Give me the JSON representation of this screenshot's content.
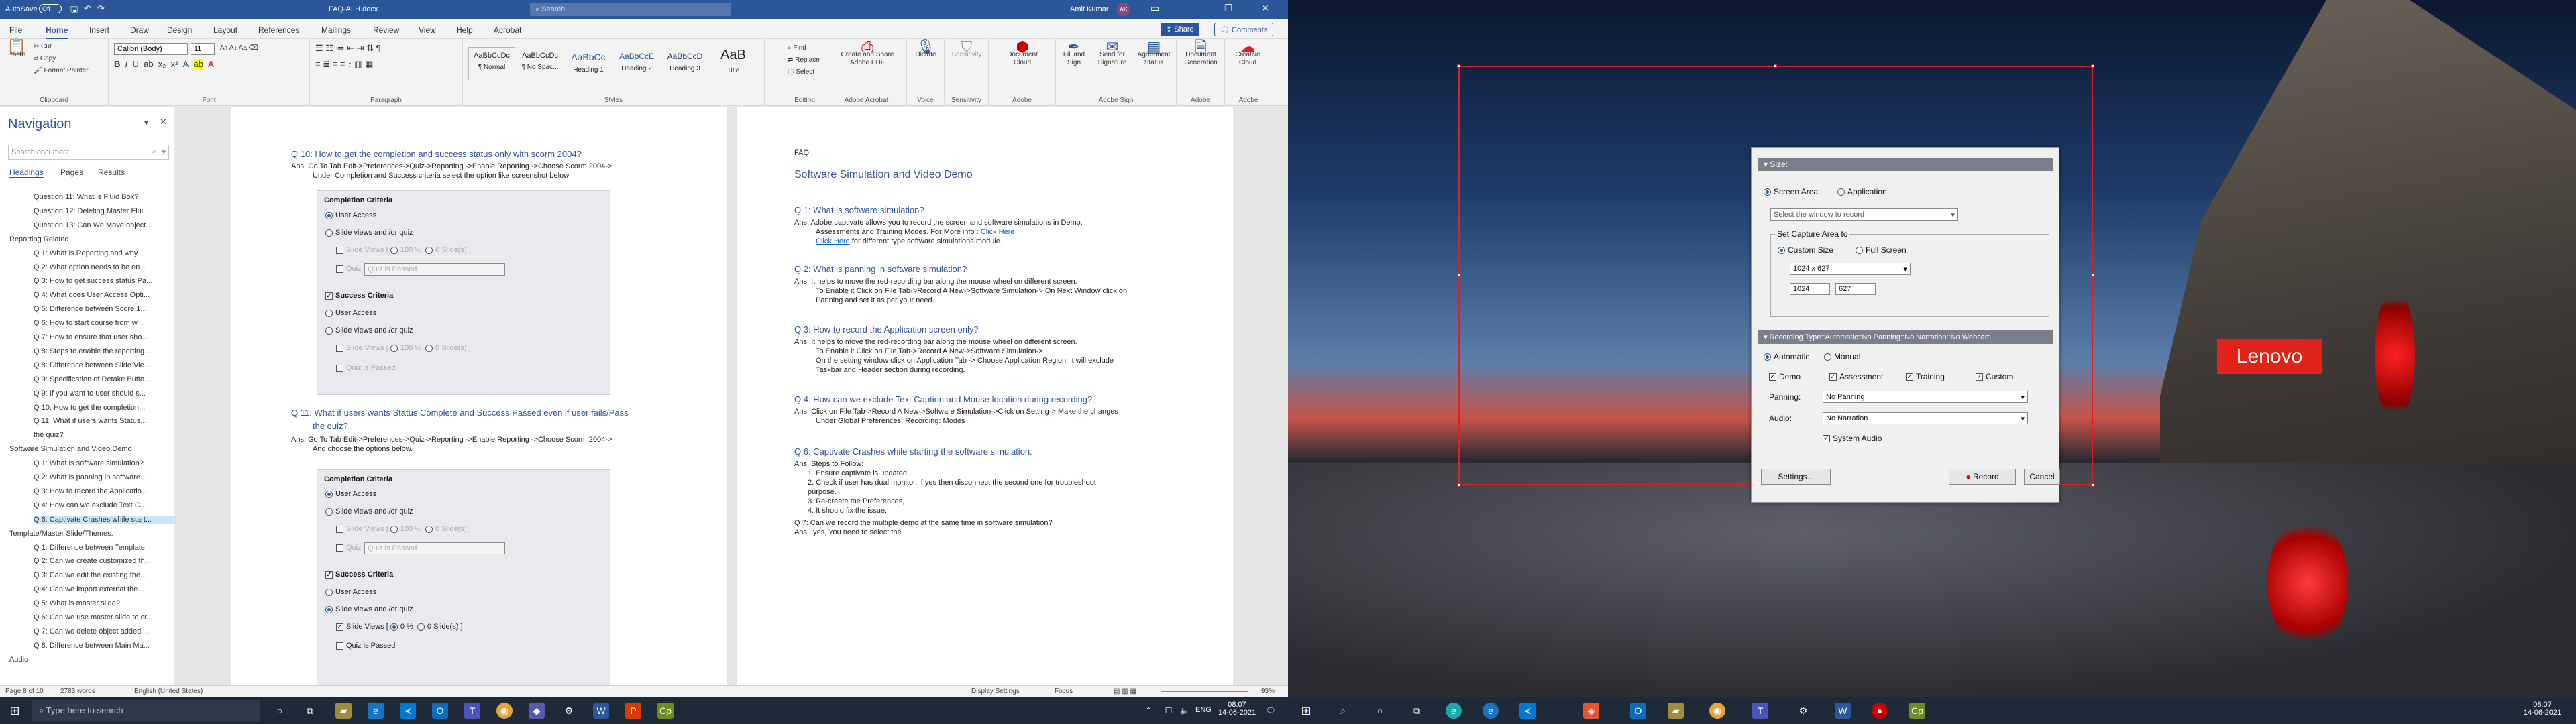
{
  "window": {
    "autosave": "AutoSave",
    "autosave_state": "Off",
    "doc_title": "FAQ-ALH.docx",
    "search": "Search",
    "user": "Amit Kumar",
    "user_initials": "AK",
    "share": "Share",
    "comments": "Comments"
  },
  "menu": [
    "File",
    "Home",
    "Insert",
    "Draw",
    "Design",
    "Layout",
    "References",
    "Mailings",
    "Review",
    "View",
    "Help",
    "Acrobat"
  ],
  "ribbon": {
    "clipboard": {
      "paste": "Paste",
      "cut": "Cut",
      "copy": "Copy",
      "format_painter": "Format Painter",
      "label": "Clipboard"
    },
    "font": {
      "name": "Calibri (Body)",
      "size": "11",
      "label": "Font"
    },
    "paragraph": {
      "label": "Paragraph"
    },
    "styles": {
      "items": [
        {
          "preview": "AaBbCcDc",
          "name": "¶ Normal"
        },
        {
          "preview": "AaBbCcDc",
          "name": "¶ No Spac..."
        },
        {
          "preview": "AaBbCc",
          "name": "Heading 1"
        },
        {
          "preview": "AaBbCcE",
          "name": "Heading 2"
        },
        {
          "preview": "AaBbCcD",
          "name": "Heading 3"
        },
        {
          "preview": "AaB",
          "name": "Title"
        }
      ],
      "label": "Styles"
    },
    "editing": {
      "find": "Find",
      "replace": "Replace",
      "select": "Select",
      "label": "Editing"
    },
    "acrobat": {
      "create": "Create and Share Adobe PDF",
      "label": "Adobe Acrobat"
    },
    "voice": {
      "dictate": "Dictate",
      "label": "Voice"
    },
    "sensitivity": {
      "name": "Sensitivity",
      "label": "Sensitivity"
    },
    "adobe": {
      "doc_cloud": "Document Cloud",
      "label": "Adobe"
    },
    "adobe_sign": {
      "fill": "Fill and Sign",
      "send": "Send for Signature",
      "status": "Agreement Status",
      "label": "Adobe Sign"
    },
    "doc_gen": {
      "name": "Document Generation",
      "label": "Adobe"
    },
    "creative": {
      "name": "Creative Cloud",
      "label": "Adobe"
    }
  },
  "navigation": {
    "title": "Navigation",
    "search_placeholder": "Search document",
    "tabs": [
      "Headings",
      "Pages",
      "Results"
    ],
    "items": [
      "Question 11: What is Fluid Box?",
      "Question 12: Deleting Master Flui...",
      "Question 13: Can We Move object...",
      "Reporting Related",
      "Q 1: What is Reporting and why...",
      "Q 2: What option needs to be en...",
      "Q 3: How to get success status Pa...",
      "Q 4: What does User Access Opti...",
      "Q 5: Difference between Score 1...",
      "Q 6: How to start course from w...",
      "Q 7: How to ensure that user sho...",
      "Q 8: Steps to enable the reporting...",
      "Q 8: Difference between Slide Vie...",
      "Q 9: Specification of Retake Butto...",
      "Q 9: If you want to user should s...",
      "Q 10: How to get the completion...",
      "Q 11: What if users wants Status...",
      "the quiz?",
      "Software Simulation and Video Demo",
      "Q 1: What is software simulation?",
      "Q 2: What is panning in software...",
      "Q 3: How to record the Applicatio...",
      "Q 4: How can we exclude Text C...",
      "Q 6: Captivate Crashes while start...",
      "Template/Master Slide/Themes.",
      "Q 1: Difference between Template...",
      "Q 2: Can we create customized th...",
      "Q 3: Can we edit the existing the...",
      "Q 4: Can we import external the...",
      "Q 5: What is master slide?",
      "Q 6: Can we use master slide to cr...",
      "Q 7: Can we delete object added i...",
      "Q 8: Difference between Main Ma...",
      "Audio"
    ]
  },
  "page1": {
    "q10": "Q 10: How to get the completion and success status only with scorm 2004?",
    "q10_ans1": "Ans:  Go To Tab Edit->Preferences->Quiz->Reporting ->Enable Reporting ->Choose Scorm 2004->",
    "q10_ans2": "Under Completion and Success criteria select the option like screenshot below",
    "panel1": {
      "completion": "Completion Criteria",
      "user_access": "User Access",
      "slide_views": "Slide views and /or quiz",
      "sv": "Slide Views",
      "pct": "100",
      "pct_unit": "%",
      "slides": "0 Slide(s)",
      "quiz": "Quiz",
      "quiz_passed": "Quiz is Passed",
      "success": "Success Criteria",
      "s_user_access": "User Access",
      "s_slide_views": "Slide views and /or quiz",
      "s_sv": "Slide Views",
      "s_pct": "100",
      "s_slides": "0 Slide(s)",
      "s_quiz": "Quiz is Passed"
    },
    "q11": "Q 11: What if users wants Status Complete and Success Passed even if user fails/Pass",
    "q11b": "the quiz?",
    "q11_ans1": "Ans:     Go To Tab Edit->Preferences->Quiz->Reporting ->Enable Reporting ->Choose Scorm 2004->",
    "q11_ans2": "And choose the options below.",
    "panel2": {
      "completion": "Completion Criteria",
      "user_access": "User Access",
      "slide_views": "Slide views and /or quiz",
      "sv": "Slide Views",
      "pct": "100",
      "slides": "0 Slide(s)",
      "quiz": "Quiz",
      "quiz_passed": "Quiz is Passed",
      "success": "Success Criteria",
      "s_user_access": "User Access",
      "s_slide_views": "Slide views and /or quiz",
      "s_sv": "Slide Views",
      "s_pct": "0",
      "s_slides": "0 Slide(s)",
      "s_quiz": "Quiz is Passed"
    }
  },
  "page2": {
    "header": "FAQ",
    "title": "Software Simulation and Video Demo",
    "q1": "Q 1: What is software simulation?",
    "q1_l1": "Ans: Adobe captivate allows you to record the screen and software simulations in Demo,",
    "q1_l2": "Assessments and Training Modes. For More info :",
    "q1_link1": "Click Here",
    "q1_link2": "Click Here",
    "q1_l3": "for different type software simulations module.",
    "q2": "Q 2: What is panning in software simulation?",
    "q2_l1": "Ans: It helps to move the red-recording bar along the mouse wheel on different screen.",
    "q2_l2": "To Enable it Click on File Tab->Record A New->Software Simulation-> On Next Window click on",
    "q2_l3": "Panning and set it as per your need.",
    "q3": "Q 3: How to record the Application screen only?",
    "q3_l1": "Ans: It helps to move the red-recording bar along the mouse wheel on different screen.",
    "q3_l2": "To Enable it Click on File Tab->Record A New->Software Simulation->",
    "q3_l3": "On the setting window click on Application Tab -> Choose Application Region, it will exclude",
    "q3_l4": "Taskbar and Header section during recording.",
    "q4": "Q 4:   How can we exclude Text Caption and Mouse location during recording?",
    "q4_l1": "Ans:  Click on File Tab->Record A New->Software Simulation->Click on Setting-> Make the changes",
    "q4_l2": "Under Global Preferences: Recording: Modes",
    "q6": "Q 6: Captivate Crashes while starting the software simulation.",
    "q6_l0": "Ans: Steps to Follow:",
    "q6_steps": [
      "1.   Ensure captivate is updated.",
      "2.   Check if user has dual monitor, if yes then disconnect the second one for troubleshoot",
      "      purpose.",
      "3.   Re-create the Preferences,",
      "4.   It should fix the issue."
    ],
    "q7": "Q 7: Can we record the multiple demo at the same time in software simulation?",
    "q7_l1": "Ans : yes, You need to select the"
  },
  "status": {
    "page": "Page 8 of 10",
    "words": "2783 words",
    "lang": "English (United States)",
    "display": "Display Settings",
    "focus": "Focus",
    "zoom": "93%"
  },
  "capture": {
    "size_header": "Size:",
    "screen_area": "Screen Area",
    "application": "Application",
    "select_window": "Select the window to record",
    "capture_area": "Set Capture Area to",
    "custom_size": "Custom Size",
    "full_screen": "Full Screen",
    "dimension": "1024 x 627",
    "width": "1024",
    "height": "627",
    "rec_header": "Recording Type::Automatic::No Panning::No Narration::No Webcam",
    "automatic": "Automatic",
    "manual": "Manual",
    "demo": "Demo",
    "assessment": "Assessment",
    "training": "Training",
    "custom": "Custom",
    "panning_label": "Panning:",
    "panning": "No Panning",
    "audio_label": "Audio:",
    "audio": "No Narration",
    "system_audio": "System Audio",
    "settings": "Settings...",
    "record": "Record",
    "cancel": "Cancel"
  },
  "brand": "Lenovo",
  "taskbar": {
    "search": "Type here to search",
    "lang": "ENG",
    "time_left": "08:07",
    "date_left": "14-06-2021",
    "time_right": "08:07",
    "date_right": "14-06-2021"
  }
}
